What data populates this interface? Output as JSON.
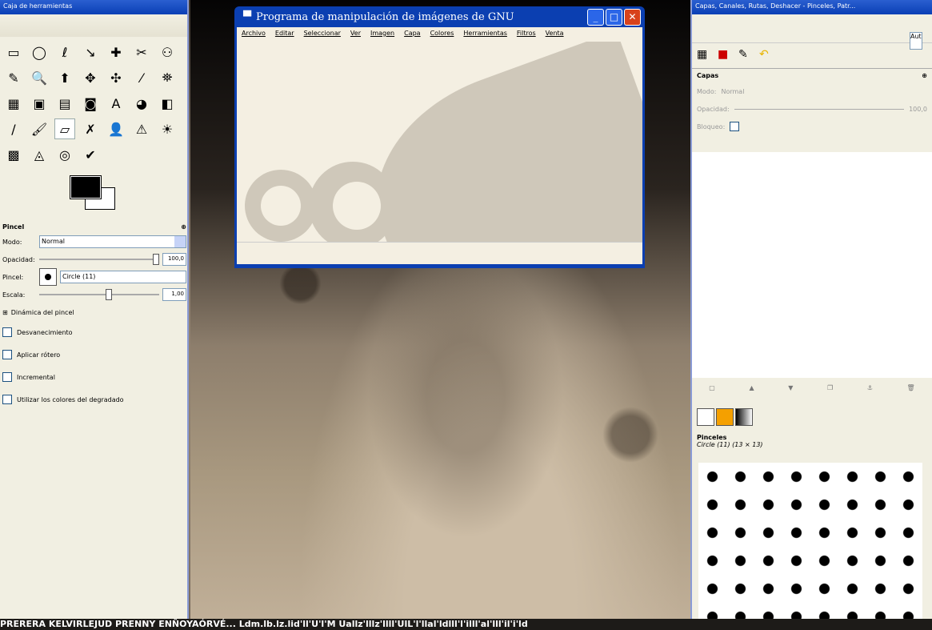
{
  "toolbox": {
    "title": "Caja de herramientas",
    "tools": [
      "▭",
      "◯",
      "ℓ",
      "↘",
      "✚",
      "✂",
      "⚇",
      "✎",
      "🔍",
      "⬆",
      "✥",
      "✣",
      "⁄",
      "⛯",
      "▦",
      "▣",
      "▤",
      "◙",
      "A",
      "◕",
      "◧",
      "/",
      "🖌",
      "▱",
      "✗",
      "👤",
      "⚠",
      "☀",
      "▩",
      "◬",
      "◎",
      "✔"
    ],
    "brush_options": {
      "title": "Pincel",
      "mode_label": "Modo:",
      "mode_value": "Normal",
      "opacity_label": "Opacidad:",
      "opacity_value": "100,0",
      "brush_label": "Pincel:",
      "brush_value": "Circle (11)",
      "scale_label": "Escala:",
      "scale_value": "1,00",
      "dynamics": "Dinámica del pincel",
      "checkboxes": [
        "Desvanecimiento",
        "Aplicar rótero",
        "Incremental",
        "Utilizar los colores del degradado"
      ]
    }
  },
  "main_window": {
    "title": "Programa de manipulación de imágenes de GNU",
    "menu": [
      "Archivo",
      "Editar",
      "Seleccionar",
      "Ver",
      "Imagen",
      "Capa",
      "Colores",
      "Herramientas",
      "Filtros",
      "Venta"
    ]
  },
  "dock": {
    "title": "Capas, Canales, Rutas, Deshacer - Pinceles, Patr...",
    "combo": "Aut",
    "layers": {
      "title": "Capas",
      "mode_label": "Modo:",
      "mode_value": "Normal",
      "opacity_label": "Opacidad:",
      "opacity_value": "100,0",
      "lock_label": "Bloqueo:"
    },
    "brushes": {
      "title": "Pinceles",
      "current": "Circle (11) (13 × 13)"
    }
  },
  "taskbar_text": "PRERERA KELVIRLEJUD PRENNY ENÑOYAÓRVÉ... Ldm.lb.lz.lid'll'U'l'M Uallz'lllz'llll'UlL'l'llal'ldlll'l'illl'al'lll'il'i'ld"
}
